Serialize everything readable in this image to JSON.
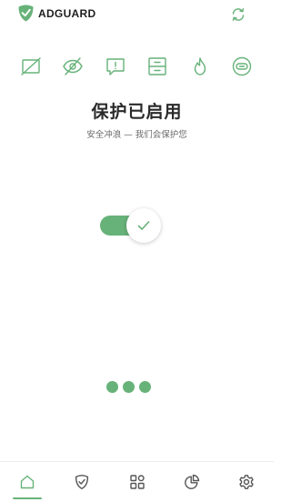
{
  "header": {
    "brand": "ADGUARD",
    "logo_icon": "adguard-shield-logo",
    "refresh_icon": "refresh-icon"
  },
  "features": [
    {
      "name": "ad-blocking-icon"
    },
    {
      "name": "tracking-protection-icon"
    },
    {
      "name": "annoyance-blocking-icon"
    },
    {
      "name": "browsing-security-icon"
    },
    {
      "name": "firewall-icon"
    },
    {
      "name": "vpn-icon"
    }
  ],
  "status": {
    "title": "保护已启用",
    "subtitle": "安全冲浪 — 我们会保护您",
    "enabled": true
  },
  "pager": {
    "count": 3
  },
  "nav": {
    "items": [
      {
        "name": "home-icon",
        "active": true
      },
      {
        "name": "protection-icon",
        "active": false
      },
      {
        "name": "apps-icon",
        "active": false
      },
      {
        "name": "statistics-icon",
        "active": false
      },
      {
        "name": "settings-icon",
        "active": false
      }
    ]
  },
  "colors": {
    "accent": "#67b279",
    "text": "#1f1f1f",
    "muted": "#6a6a6a"
  }
}
